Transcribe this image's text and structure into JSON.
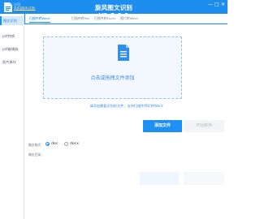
{
  "titlebar": {
    "user_name": "小可",
    "user_link": "未激活版本(试用)",
    "title": "旋风图文识别 V1.3.0.0",
    "controls": [
      "—",
      "□",
      "✕"
    ]
  },
  "sidebar": {
    "items": [
      {
        "label": "图文识别",
        "active": true
      },
      {
        "label": "pdf转换",
        "active": false
      },
      {
        "label": "pdf编辑器",
        "active": false
      },
      {
        "label": "图片操作",
        "active": false
      }
    ]
  },
  "tabs": [
    {
      "label": "扫描件转Word",
      "active": true
    },
    {
      "label": "扫描件转Ppt",
      "active": false
    },
    {
      "label": "扫描件转Excel",
      "active": false
    },
    {
      "label": "图片转Word",
      "active": false
    }
  ],
  "dropzone": {
    "text": "点击或拖拽文件添加",
    "icon": "word-document-icon"
  },
  "hint": "请添加需要识别的文件，支持扫描件PDF转Word",
  "buttons": {
    "add": "添加文件",
    "start": "开始转换"
  },
  "output_format": {
    "label": "输出格式：",
    "options": [
      {
        "label": "doc",
        "checked": true
      },
      {
        "label": "docx",
        "checked": false
      }
    ]
  },
  "output_dir": {
    "label": "输出目录："
  },
  "colors": {
    "brand": "#1e8df0",
    "accent_text": "#3a8ae8"
  }
}
